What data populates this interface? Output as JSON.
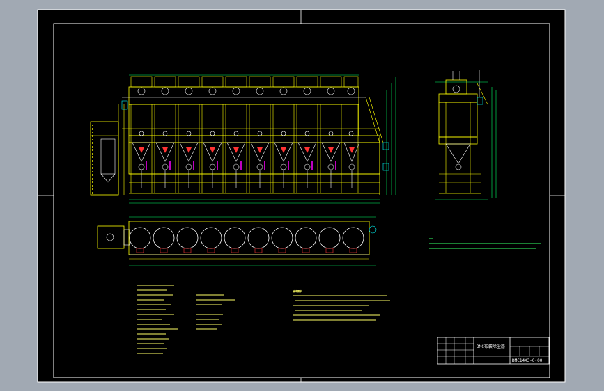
{
  "drawing": {
    "title": "DMC布袋除尘器",
    "drawing_number": "DMC14X3-0-00",
    "technical_notes_heading": "技术要求",
    "colors": {
      "background": "#000000",
      "outer_gray": "#a1a9b3",
      "frame": "#ffffff",
      "structure_yellow": "#ffff00",
      "dimension_green": "#00ff66",
      "accent_cyan": "#00ffff",
      "accent_magenta": "#ff00ff",
      "accent_red": "#ff3333"
    }
  },
  "views": {
    "front_elevation": {
      "chamber_count": 10
    },
    "plan_view": {
      "chamber_count": 10
    },
    "side_elevation": {
      "chamber_count": 1
    }
  }
}
